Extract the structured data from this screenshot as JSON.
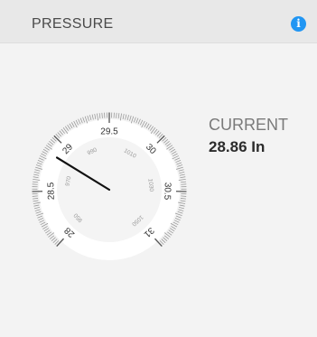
{
  "widget": {
    "title": "PRESSURE",
    "info_icon": "info-icon",
    "accent": "#2196f3"
  },
  "gauge": {
    "outer_labels": [
      "28",
      "28.5",
      "29",
      "29.5",
      "30",
      "30.5",
      "31"
    ],
    "inner_labels": [
      "950",
      "970",
      "990",
      "1010",
      "1030",
      "1050"
    ],
    "value_in": 28.86
  },
  "current": {
    "label": "CURRENT",
    "value": "28.86 In"
  }
}
